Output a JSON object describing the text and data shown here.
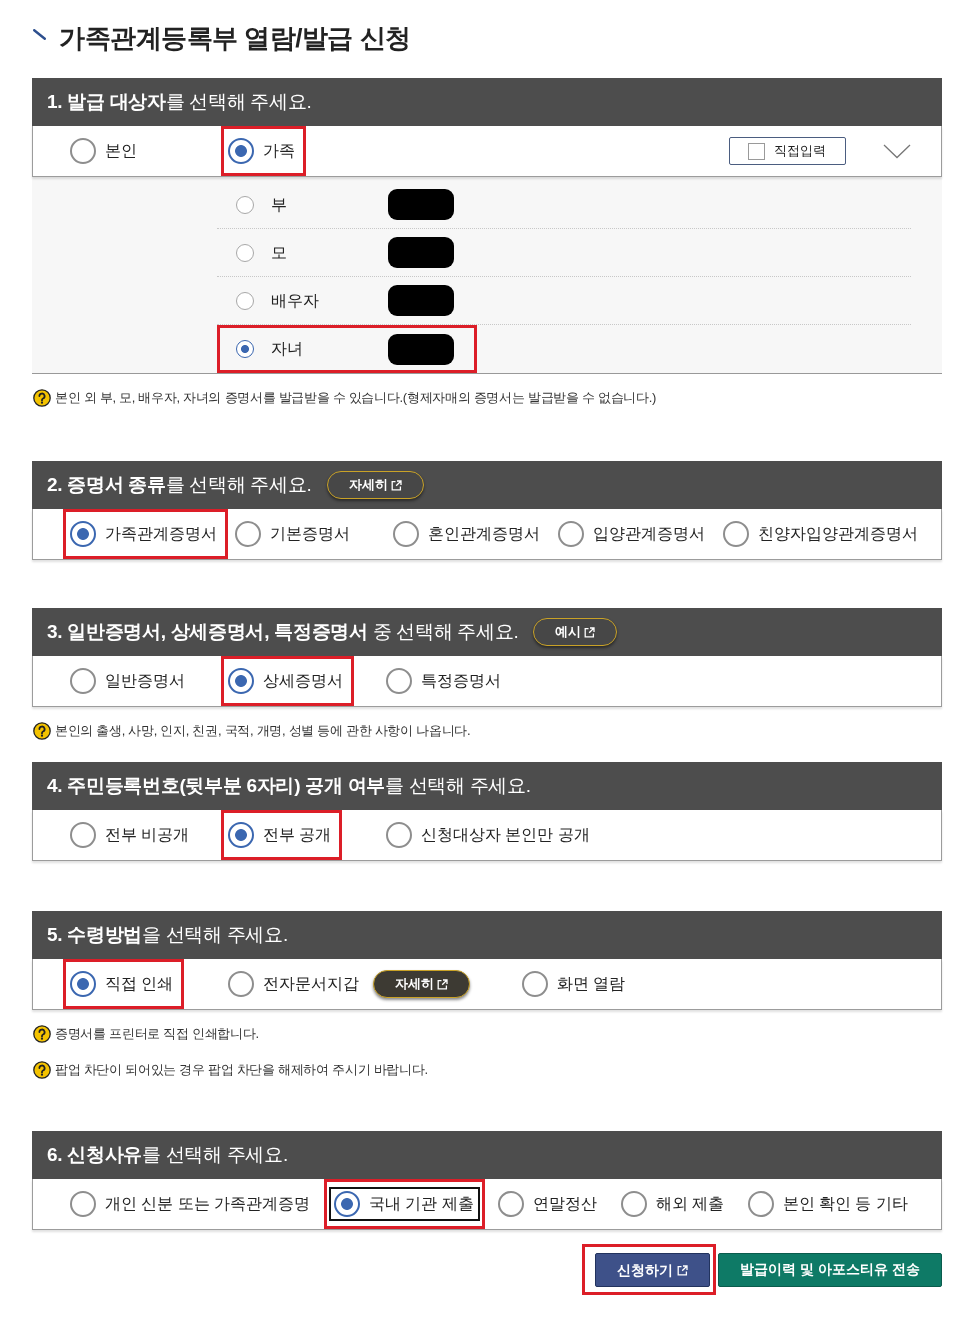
{
  "title": "가족관계등록부 열람/발급 신청",
  "sections": [
    {
      "heading": "**1. 발급 대상자**를 선택해 주세요.",
      "options": [
        {
          "label": "본인",
          "selected": false,
          "highlighted": false
        },
        {
          "label": "가족",
          "selected": true,
          "highlighted": true
        }
      ],
      "direct_input": {
        "label": "직접입력",
        "checked": false
      },
      "members": [
        {
          "label": "부",
          "selected": false,
          "highlighted": false,
          "redacted": true
        },
        {
          "label": "모",
          "selected": false,
          "highlighted": false,
          "redacted": true
        },
        {
          "label": "배우자",
          "selected": false,
          "highlighted": false,
          "redacted": true
        },
        {
          "label": "자녀",
          "selected": true,
          "highlighted": true,
          "redacted": true
        }
      ],
      "notes": [
        "본인 외 부, 모, 배우자, 자녀의 증명서를 발급받을 수 있습니다.(형제자매의 증명서는 발급받을 수 없습니다.)"
      ]
    },
    {
      "heading": "**2. 증명서 종류**를 선택해 주세요.",
      "button": {
        "label": "자세히",
        "external": true
      },
      "options": [
        {
          "label": "가족관계증명서",
          "selected": true,
          "highlighted": true
        },
        {
          "label": "기본증명서",
          "selected": false,
          "highlighted": false
        },
        {
          "label": "혼인관계증명서",
          "selected": false,
          "highlighted": false
        },
        {
          "label": "입양관계증명서",
          "selected": false,
          "highlighted": false
        },
        {
          "label": "친양자입양관계증명서",
          "selected": false,
          "highlighted": false
        }
      ]
    },
    {
      "heading": "**3. 일반증명서, 상세증명서, 특정증명서** 중 선택해 주세요.",
      "button": {
        "label": "예시",
        "external": true
      },
      "options": [
        {
          "label": "일반증명서",
          "selected": false,
          "highlighted": false
        },
        {
          "label": "상세증명서",
          "selected": true,
          "highlighted": true
        },
        {
          "label": "특정증명서",
          "selected": false,
          "highlighted": false
        }
      ],
      "notes": [
        "본인의 출생, 사망, 인지, 친권, 국적, 개명, 성별 등에 관한 사항이 나옵니다."
      ]
    },
    {
      "heading": "**4. 주민등록번호(뒷부분 6자리) 공개 여부**를 선택해 주세요.",
      "options": [
        {
          "label": "전부 비공개",
          "selected": false,
          "highlighted": false
        },
        {
          "label": "전부 공개",
          "selected": true,
          "highlighted": true
        },
        {
          "label": "신청대상자 본인만 공개",
          "selected": false,
          "highlighted": false
        }
      ]
    },
    {
      "heading": "**5. 수령방법**을 선택해 주세요.",
      "options": [
        {
          "label": "직접 인쇄",
          "selected": true,
          "highlighted": true
        },
        {
          "label": "전자문서지갑",
          "selected": false,
          "highlighted": false,
          "button": {
            "label": "자세히",
            "external": true
          }
        },
        {
          "label": "화면 열람",
          "selected": false,
          "highlighted": false
        }
      ],
      "notes": [
        "증명서를 프린터로 직접 인쇄합니다.",
        "팝업 차단이 되어있는 경우 팝업 차단을 해제하여 주시기 바랍니다."
      ]
    },
    {
      "heading": "**6. 신청사유**를 선택해 주세요.",
      "options": [
        {
          "label": "개인 신분 또는 가족관계증명",
          "selected": false,
          "highlighted": false,
          "focused": false
        },
        {
          "label": "국내 기관 제출",
          "selected": true,
          "highlighted": true,
          "focused": true
        },
        {
          "label": "연말정산",
          "selected": false,
          "highlighted": false,
          "focused": false
        },
        {
          "label": "해외 제출",
          "selected": false,
          "highlighted": false,
          "focused": false
        },
        {
          "label": "본인 확인 등 기타",
          "selected": false,
          "highlighted": false,
          "focused": false
        }
      ]
    }
  ],
  "buttons": [
    {
      "label": "신청하기",
      "kind": "primary",
      "external": true,
      "highlighted": true
    },
    {
      "label": "발급이력 및 아포스티유 전송",
      "kind": "success",
      "external": false,
      "highlighted": false
    }
  ]
}
